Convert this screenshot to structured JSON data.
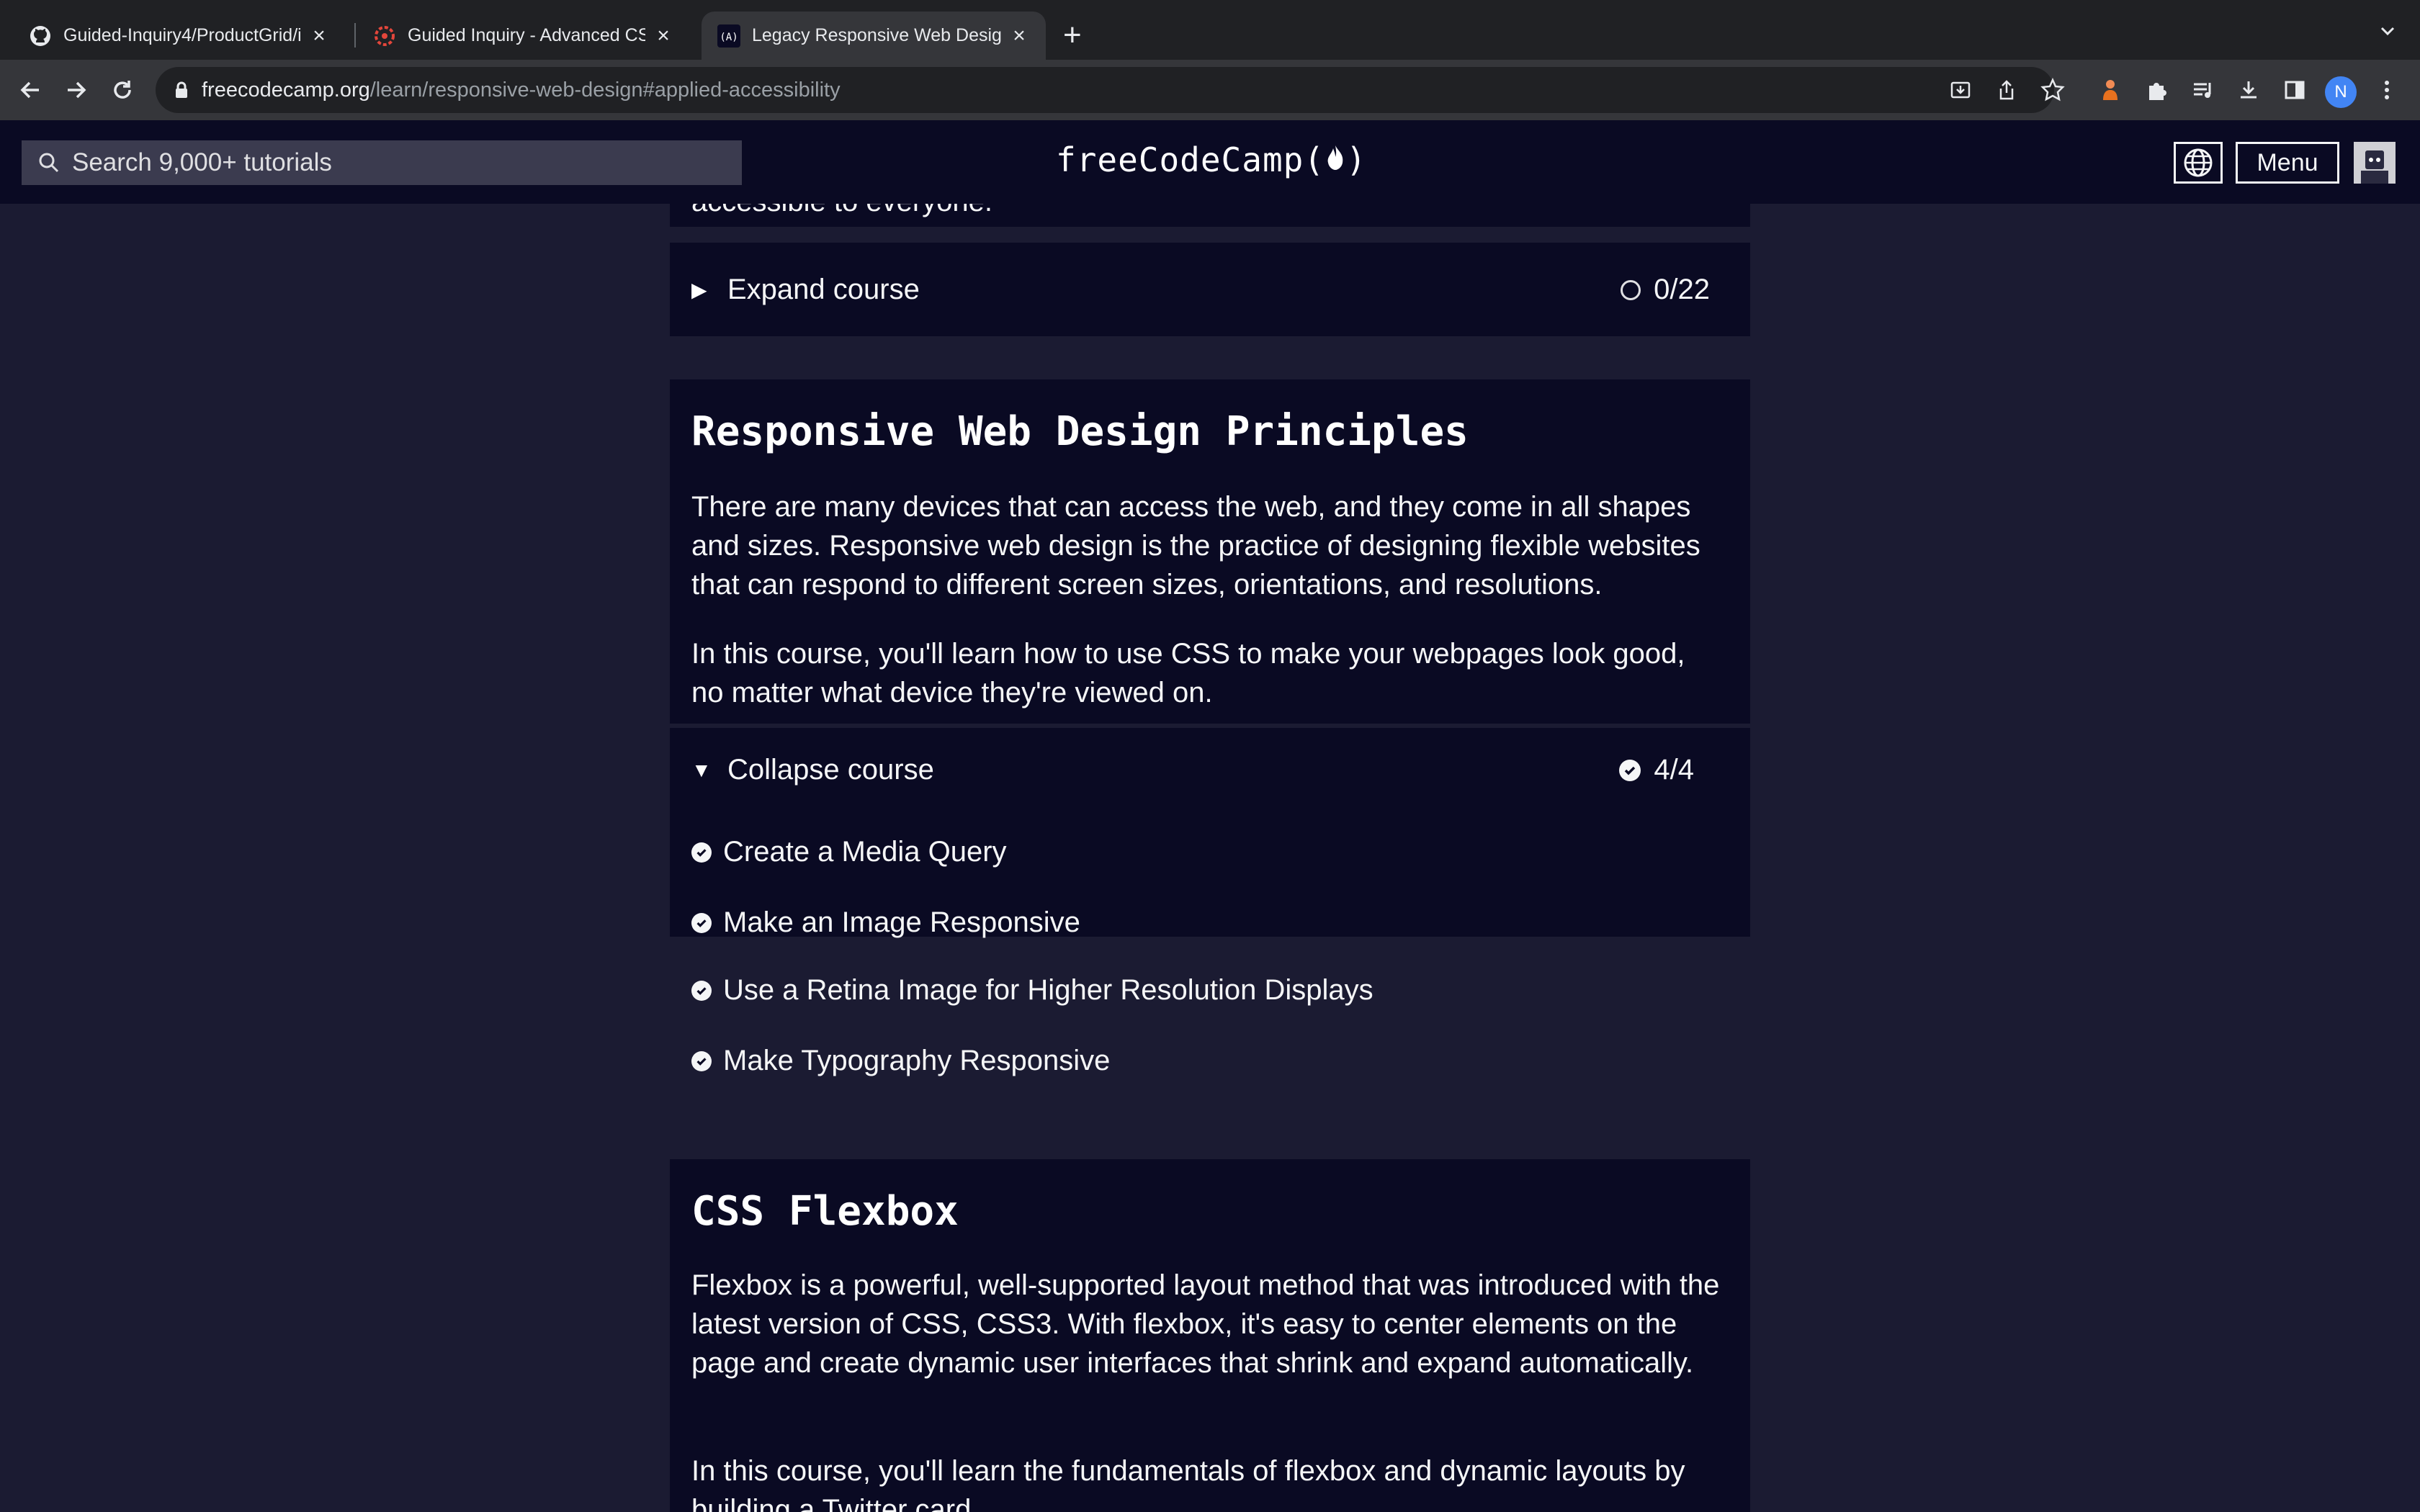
{
  "browser": {
    "tabs": [
      {
        "title": "Guided-Inquiry4/ProductGrid/i",
        "favicon": "github-icon",
        "active": false
      },
      {
        "title": "Guided Inquiry - Advanced CS",
        "favicon": "canvas-icon",
        "active": false
      },
      {
        "title": "Legacy Responsive Web Desig",
        "favicon": "freecodecamp-icon",
        "active": true
      }
    ],
    "url_host": "freecodecamp.org",
    "url_path": "/learn/responsive-web-design#applied-accessibility",
    "profile_initial": "N"
  },
  "fcc_nav": {
    "search_placeholder": "Search 9,000+ tutorials",
    "logo": "freeCodeCamp(🔥)",
    "logo_text": "freeCodeCamp(",
    "logo_close": ")",
    "menu_label": "Menu"
  },
  "previous_block": {
    "cutoff_text": "accessible to everyone.",
    "toggle_label": "Expand course",
    "progress": "0/22"
  },
  "rwd_principles": {
    "title": "Responsive Web Design Principles",
    "paragraphs": [
      "There are many devices that can access the web, and they come in all shapes and sizes. Responsive web design is the practice of designing flexible websites that can respond to different screen sizes, orientations, and resolutions.",
      "In this course, you'll learn how to use CSS to make your webpages look good, no matter what device they're viewed on."
    ],
    "toggle_label": "Collapse course",
    "progress": "4/4",
    "challenges": [
      "Create a Media Query",
      "Make an Image Responsive",
      "Use a Retina Image for Higher Resolution Displays",
      "Make Typography Responsive"
    ]
  },
  "css_flexbox": {
    "title": "CSS Flexbox",
    "paragraphs": [
      "Flexbox is a powerful, well-supported layout method that was introduced with the latest version of CSS, CSS3. With flexbox, it's easy to center elements on the page and create dynamic user interfaces that shrink and expand automatically.",
      "In this course, you'll learn the fundamentals of flexbox and dynamic layouts by building a Twitter card."
    ]
  }
}
